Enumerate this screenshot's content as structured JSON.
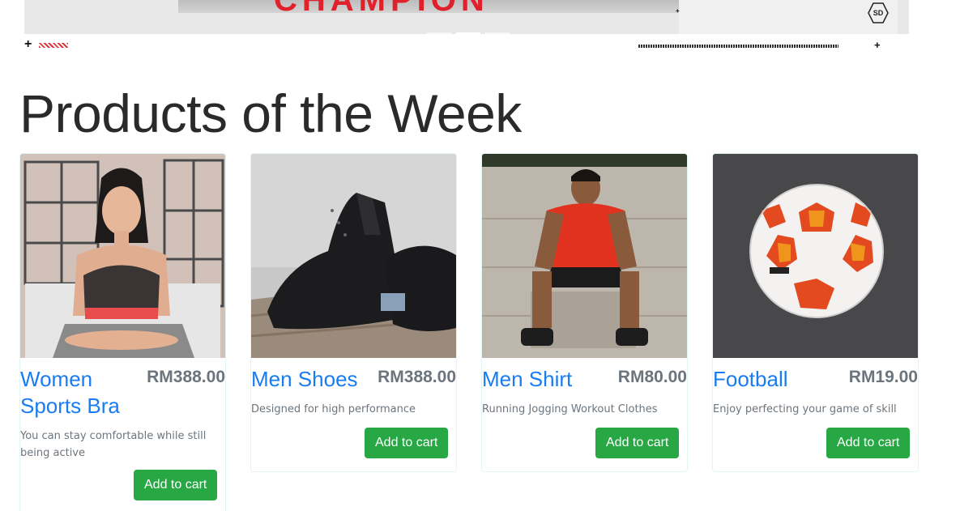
{
  "banner": {
    "badge": "SD",
    "brand_text": "CHAMPION",
    "slides": 3,
    "active_slide": 2
  },
  "section": {
    "title": "Products of the Week"
  },
  "products": [
    {
      "name": "Women Sports Bra",
      "price": "RM388.00",
      "description": "You can stay comfortable while still being active",
      "button": "Add to cart",
      "image": "woman-sports-bra-photo"
    },
    {
      "name": "Men Shoes",
      "price": "RM388.00",
      "description": "Designed for high performance",
      "button": "Add to cart",
      "image": "black-running-shoes-photo"
    },
    {
      "name": "Men Shirt",
      "price": "RM80.00",
      "description": "Running Jogging Workout Clothes",
      "button": "Add to cart",
      "image": "man-red-shirt-photo"
    },
    {
      "name": "Football",
      "price": "RM19.00",
      "description": "Enjoy perfecting your game of skill",
      "button": "Add to cart",
      "image": "champions-league-ball-photo"
    }
  ],
  "colors": {
    "title_blue": "#1a7cf2",
    "price_gray": "#6c757d",
    "button_green": "#28a745"
  }
}
